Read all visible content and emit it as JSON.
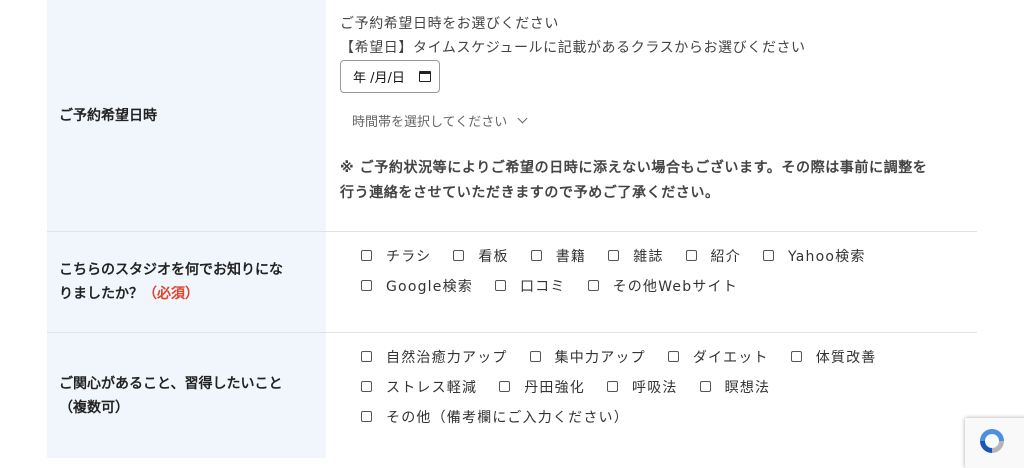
{
  "reservation": {
    "label": "ご予約希望日時",
    "hint1": "ご予約希望日時をお選びください",
    "hint2": "【希望日】タイムスケジュールに記載があるクラスからお選びください",
    "date_value": "年 /月/日",
    "time_select": "時間帯を選択してください",
    "note_line1": "※ ご予約状況等によりご希望の日時に添えない場合もございます。その際は事前に調整を",
    "note_line2": "行う連絡をさせていただきますので予めご了承ください。"
  },
  "source": {
    "label": "こちらのスタジオを何でお知りにな",
    "label2": "りましたか？",
    "required": "（必須）",
    "options": [
      "チラシ",
      "看板",
      "書籍",
      "雑誌",
      "紹介",
      "Yahoo検索",
      "Google検索",
      "口コミ",
      "その他Webサイト"
    ]
  },
  "interests": {
    "label": "ご関心があること、習得したいこと",
    "label2": "（複数可）",
    "options": [
      "自然治癒力アップ",
      "集中力アップ",
      "ダイエット",
      "体質改善",
      "ストレス軽減",
      "丹田強化",
      "呼吸法",
      "瞑想法",
      "その他（備考欄にご入力ください）"
    ]
  },
  "colors": {
    "label_bg": "#f0f6fb",
    "required": "#e0442c"
  },
  "icons": {
    "date": "calendar-icon",
    "select": "chevron-down-icon",
    "captcha": "recaptcha-logo-icon"
  }
}
